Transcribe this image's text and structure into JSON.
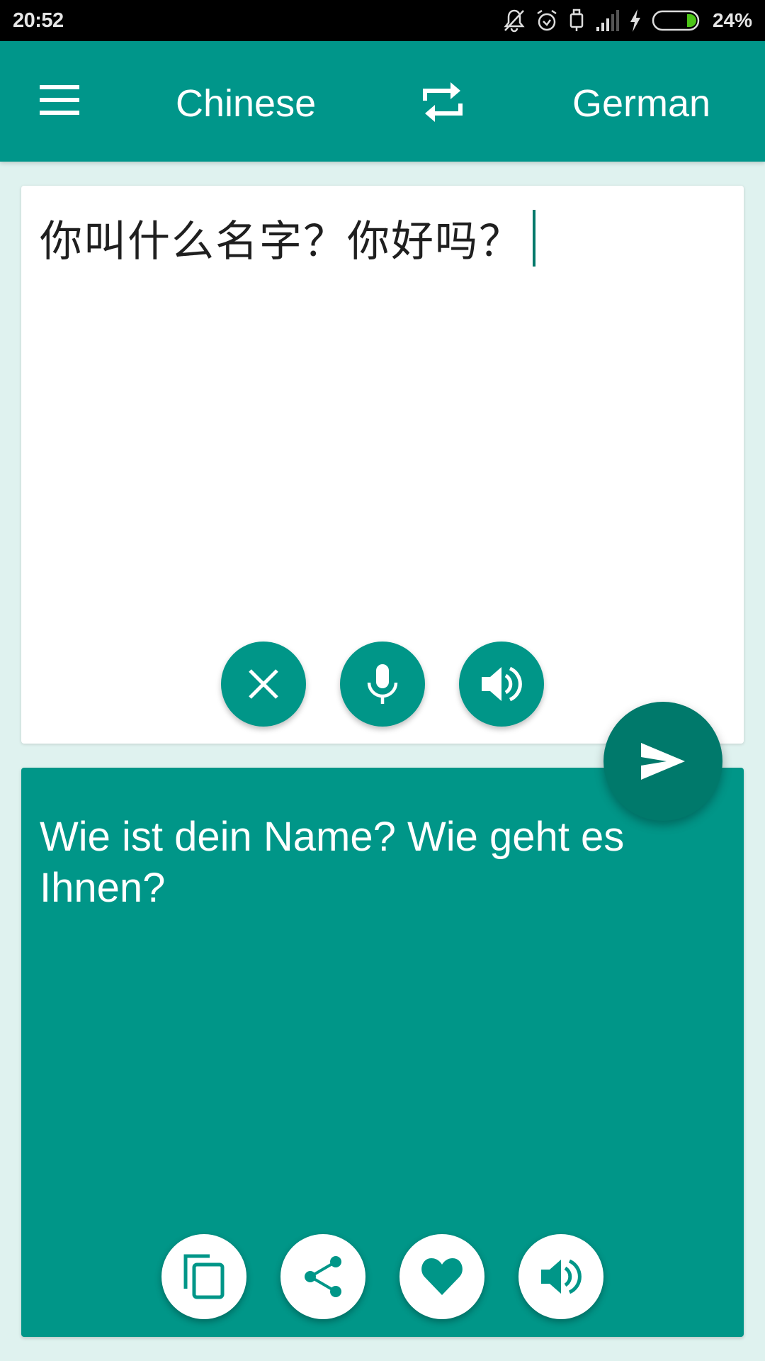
{
  "status_bar": {
    "time": "20:52",
    "icons": [
      "notifications-off-icon",
      "alarm-icon",
      "usb-icon",
      "signal-icon",
      "charging-icon",
      "battery-icon"
    ],
    "battery_percent": "24%",
    "battery_level": 0.24,
    "battery_color": "#4cc417"
  },
  "toolbar": {
    "menu_icon": "hamburger-menu-icon",
    "source_language": "Chinese",
    "swap_icon": "swap-languages-icon",
    "target_language": "German",
    "background_color": "#00968a"
  },
  "source_panel": {
    "input_text": "你叫什么名字？你好吗？",
    "buttons": [
      {
        "name": "clear",
        "icon": "close-icon"
      },
      {
        "name": "voice-input",
        "icon": "microphone-icon"
      },
      {
        "name": "speak-source",
        "icon": "speaker-icon"
      }
    ]
  },
  "translate_button": {
    "icon": "send-icon"
  },
  "target_panel": {
    "output_text": "Wie ist dein Name? Wie geht es Ihnen?",
    "buttons": [
      {
        "name": "copy",
        "icon": "copy-icon"
      },
      {
        "name": "share",
        "icon": "share-icon"
      },
      {
        "name": "favorite",
        "icon": "heart-icon"
      },
      {
        "name": "speak-target",
        "icon": "speaker-icon"
      }
    ],
    "background_color": "#009688"
  }
}
